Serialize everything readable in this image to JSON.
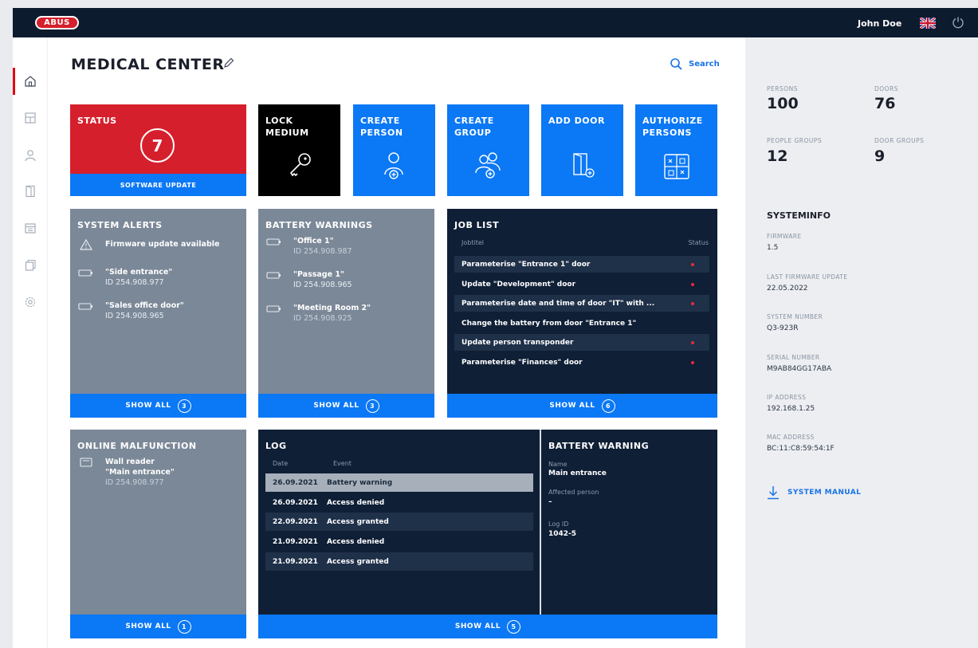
{
  "brand": {
    "logo_text": "ABUS"
  },
  "header": {
    "user_name": "John Doe"
  },
  "page": {
    "title": "MEDICAL CENTER",
    "search_label": "Search"
  },
  "tiles": {
    "status": {
      "title": "STATUS",
      "count": "7",
      "footer": "SOFTWARE UPDATE"
    },
    "lock_medium": {
      "title_line1": "LOCK",
      "title_line2": "MEDIUM"
    },
    "create_person": {
      "title_line1": "CREATE",
      "title_line2": "PERSON"
    },
    "create_group": {
      "title_line1": "CREATE",
      "title_line2": "GROUP"
    },
    "add_door": {
      "title_line1": "ADD DOOR"
    },
    "authorize_persons": {
      "title_line1": "AUTHORIZE",
      "title_line2": "PERSONS"
    }
  },
  "system_alerts": {
    "title": "SYSTEM ALERTS",
    "items": [
      {
        "title": "Firmware update available"
      },
      {
        "title": "\"Side entrance\"",
        "id": "ID 254.908.977"
      },
      {
        "title": "\"Sales office door\"",
        "id": "ID 254.908.965"
      }
    ],
    "footer": "SHOW ALL",
    "count": "3"
  },
  "battery_warnings": {
    "title": "BATTERY WARNINGS",
    "items": [
      {
        "title": "\"Office 1\"",
        "id": "ID 254.908.987"
      },
      {
        "title": "\"Passage 1\"",
        "id": "ID 254.908.965"
      },
      {
        "title": "\"Meeting Room 2\"",
        "id": "ID 254.908.925"
      }
    ],
    "footer": "SHOW ALL",
    "count": "3"
  },
  "job_list": {
    "title": "JOB LIST",
    "col_jobtitle": "Jobtitel",
    "col_status": "Status",
    "rows": [
      "Parameterise \"Entrance 1\" door",
      "Update \"Development\" door",
      "Parameterise date and time of door \"IT\" with ...",
      "Change the battery from door \"Entrance 1\"",
      "Update person transponder",
      "Parameterise \"Finances\" door"
    ],
    "footer": "SHOW ALL",
    "count": "6"
  },
  "online_malfunction": {
    "title": "ONLINE MALFUNCTION",
    "item": {
      "line1": "Wall reader",
      "line2": "\"Main entrance\"",
      "id": "ID 254.908.977"
    },
    "footer": "SHOW ALL",
    "count": "1"
  },
  "log": {
    "title": "LOG",
    "col_date": "Date",
    "col_event": "Event",
    "rows": [
      {
        "date": "26.09.2021",
        "event": "Battery warning"
      },
      {
        "date": "26.09.2021",
        "event": "Access denied"
      },
      {
        "date": "22.09.2021",
        "event": "Access granted"
      },
      {
        "date": "21.09.2021",
        "event": "Access denied"
      },
      {
        "date": "21.09.2021",
        "event": "Access granted"
      }
    ],
    "footer": "SHOW ALL",
    "count": "5"
  },
  "battery_warning_detail": {
    "title": "BATTERY WARNING",
    "name_label": "Name",
    "name_value": "Main entrance",
    "person_label": "Affected person",
    "person_value": "–",
    "logid_label": "Log ID",
    "logid_value": "1042-5"
  },
  "stats": {
    "persons_label": "PERSONS",
    "persons_value": "100",
    "doors_label": "DOORS",
    "doors_value": "76",
    "people_groups_label": "PEOPLE GROUPS",
    "people_groups_value": "12",
    "door_groups_label": "DOOR GROUPS",
    "door_groups_value": "9"
  },
  "systeminfo": {
    "title": "SYSTEMINFO",
    "firmware_label": "FIRMWARE",
    "firmware_value": "1.5",
    "last_update_label": "LAST FIRMWARE UPDATE",
    "last_update_value": "22.05.2022",
    "system_number_label": "SYSTEM NUMBER",
    "system_number_value": "Q3-923R",
    "serial_label": "SERIAL NUMBER",
    "serial_value": "M9AB84GG17ABA",
    "ip_label": "IP ADDRESS",
    "ip_value": "192.168.1.25",
    "mac_label": "MAC ADDRESS",
    "mac_value": "BC:11:C8:59:54:1F",
    "manual_label": "SYSTEM MANUAL"
  },
  "colors": {
    "navy": "#0d1b2e",
    "blue": "#0b78f5",
    "red": "#d61f2c",
    "gray": "#7b8898",
    "dark_tile": "#0f1f36"
  }
}
